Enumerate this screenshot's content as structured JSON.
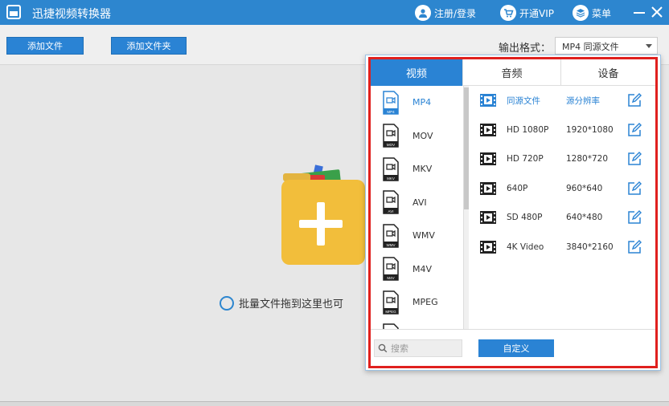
{
  "app": {
    "title": "迅捷视频转换器"
  },
  "titlebar": {
    "login_label": "注册/登录",
    "vip_label": "开通VIP",
    "menu_label": "菜单"
  },
  "toolbar": {
    "add_file": "添加文件",
    "add_folder": "添加文件夹",
    "output_label": "输出格式：",
    "output_value": "MP4 同源文件"
  },
  "main": {
    "drag_hint": "批量文件拖到这里也可"
  },
  "panel": {
    "tabs": [
      {
        "label": "视频",
        "active": true
      },
      {
        "label": "音频",
        "active": false
      },
      {
        "label": "设备",
        "active": false
      }
    ],
    "formats": [
      {
        "label": "MP4",
        "badge": "MP4",
        "active": true
      },
      {
        "label": "MOV",
        "badge": "MOV",
        "active": false
      },
      {
        "label": "MKV",
        "badge": "MKV",
        "active": false
      },
      {
        "label": "AVI",
        "badge": "AVI",
        "active": false
      },
      {
        "label": "WMV",
        "badge": "WMV",
        "active": false
      },
      {
        "label": "M4V",
        "badge": "M4V",
        "active": false
      },
      {
        "label": "MPEG",
        "badge": "MPEG",
        "active": false
      }
    ],
    "resolutions": [
      {
        "name": "同源文件",
        "size": "源分辨率",
        "active": true
      },
      {
        "name": "HD 1080P",
        "size": "1920*1080",
        "active": false
      },
      {
        "name": "HD 720P",
        "size": "1280*720",
        "active": false
      },
      {
        "name": "640P",
        "size": "960*640",
        "active": false
      },
      {
        "name": "SD 480P",
        "size": "640*480",
        "active": false
      },
      {
        "name": "4K Video",
        "size": "3840*2160",
        "active": false
      }
    ],
    "search_placeholder": "搜索",
    "custom_label": "自定义"
  },
  "colors": {
    "accent": "#2a83d4",
    "titlebar": "#2d86cf",
    "highlight": "#e0201e"
  }
}
